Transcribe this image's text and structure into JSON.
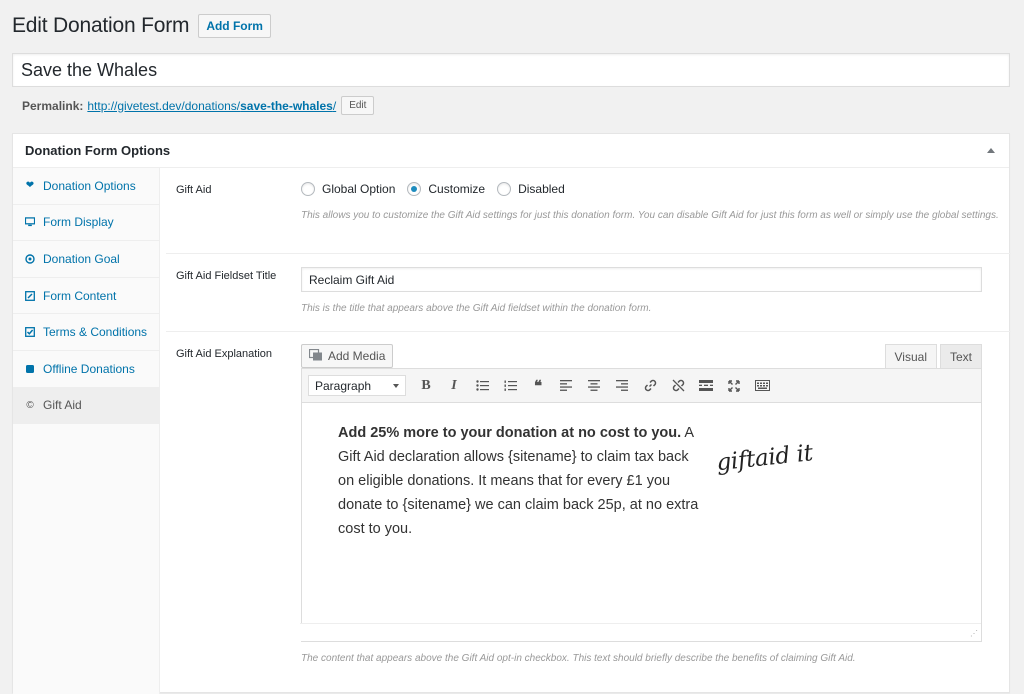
{
  "header": {
    "title": "Edit Donation Form",
    "add_form_label": "Add Form"
  },
  "post_title": "Save the Whales",
  "permalink": {
    "label": "Permalink:",
    "url_base": "http://givetest.dev/donations/",
    "slug": "save-the-whales",
    "slash": "/",
    "edit_label": "Edit"
  },
  "metabox": {
    "title": "Donation Form Options",
    "tabs": [
      {
        "label": "Donation Options",
        "icon": "heart-icon"
      },
      {
        "label": "Form Display",
        "icon": "monitor-icon"
      },
      {
        "label": "Donation Goal",
        "icon": "target-icon"
      },
      {
        "label": "Form Content",
        "icon": "edit-icon"
      },
      {
        "label": "Terms & Conditions",
        "icon": "checkbox-icon"
      },
      {
        "label": "Offline Donations",
        "icon": "database-icon"
      },
      {
        "label": "Gift Aid",
        "icon": "copyright-icon"
      }
    ],
    "active_tab": "Gift Aid"
  },
  "gift_aid": {
    "label": "Gift Aid",
    "options": [
      "Global Option",
      "Customize",
      "Disabled"
    ],
    "selected": "Customize",
    "description": "This allows you to customize the Gift Aid settings for just this donation form. You can disable Gift Aid for just this form as well or simply use the global settings."
  },
  "fieldset_title": {
    "label": "Gift Aid Fieldset Title",
    "value": "Reclaim Gift Aid",
    "description": "This is the title that appears above the Gift Aid fieldset within the donation form."
  },
  "explanation": {
    "label": "Gift Aid Explanation",
    "add_media_label": "Add Media",
    "tab_visual": "Visual",
    "tab_text": "Text",
    "format_select": "Paragraph",
    "content_bold": "Add 25% more to your donation at no cost to you.",
    "content_rest": " A Gift Aid declaration allows {sitename} to claim tax back on eligible donations. It means that for every £1 you donate to {sitename} we can claim back 25p, at no extra cost to you.",
    "logo_text": "giftaid it",
    "description": "The content that appears above the Gift Aid opt-in checkbox. This text should briefly describe the benefits of claiming Gift Aid."
  },
  "colors": {
    "link": "#0073aa",
    "radio_checked": "#1e8cbe"
  }
}
